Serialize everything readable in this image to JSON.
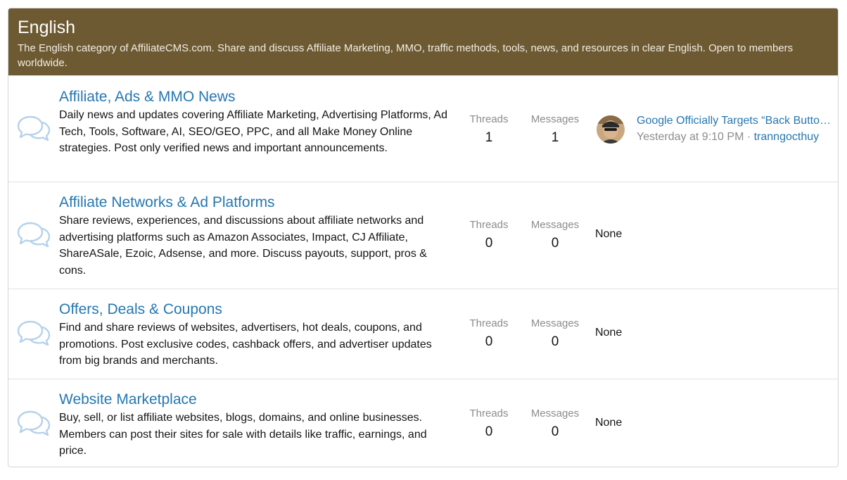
{
  "category": {
    "title": "English",
    "description": "The English category of AffiliateCMS.com. Share and discuss Affiliate Marketing, MMO, traffic methods, tools, news, and resources in clear English. Open to members worldwide."
  },
  "stat_labels": {
    "threads": "Threads",
    "messages": "Messages"
  },
  "forums": [
    {
      "title": "Affiliate, Ads & MMO News",
      "description": "Daily news and updates covering Affiliate Marketing, Advertising Platforms, Ad Tech, Tools, Software, AI, SEO/GEO, PPC, and all Make Money Online strategies. Post only verified news and important announcements.",
      "threads": "1",
      "messages": "1",
      "latest": {
        "title": "Google Officially Targets “Back Button Hijacking”",
        "time": "Yesterday at 9:10 PM",
        "separator": " · ",
        "user": "tranngocthuy"
      }
    },
    {
      "title": "Affiliate Networks & Ad Platforms",
      "description": "Share reviews, experiences, and discussions about affiliate networks and advertising platforms such as Amazon Associates, Impact, CJ Affiliate, ShareASale, Ezoic, Adsense, and more. Discuss payouts, support, pros & cons.",
      "threads": "0",
      "messages": "0",
      "latest_none": "None"
    },
    {
      "title": "Offers, Deals & Coupons",
      "description": "Find and share reviews of websites, advertisers, hot deals, coupons, and promotions. Post exclusive codes, cashback offers, and advertiser updates from big brands and merchants.",
      "threads": "0",
      "messages": "0",
      "latest_none": "None"
    },
    {
      "title": "Website Marketplace",
      "description": "Buy, sell, or list affiliate websites, blogs, domains, and online businesses. Members can post their sites for sale with details like traffic, earnings, and price.",
      "threads": "0",
      "messages": "0",
      "latest_none": "None"
    }
  ],
  "icons": {
    "forum": "chat-bubbles-icon",
    "avatar": "user-avatar"
  },
  "colors": {
    "header_bg": "#6d5a32",
    "link": "#2577b1",
    "icon": "#b6d1ea",
    "muted": "#8c8c8c"
  }
}
